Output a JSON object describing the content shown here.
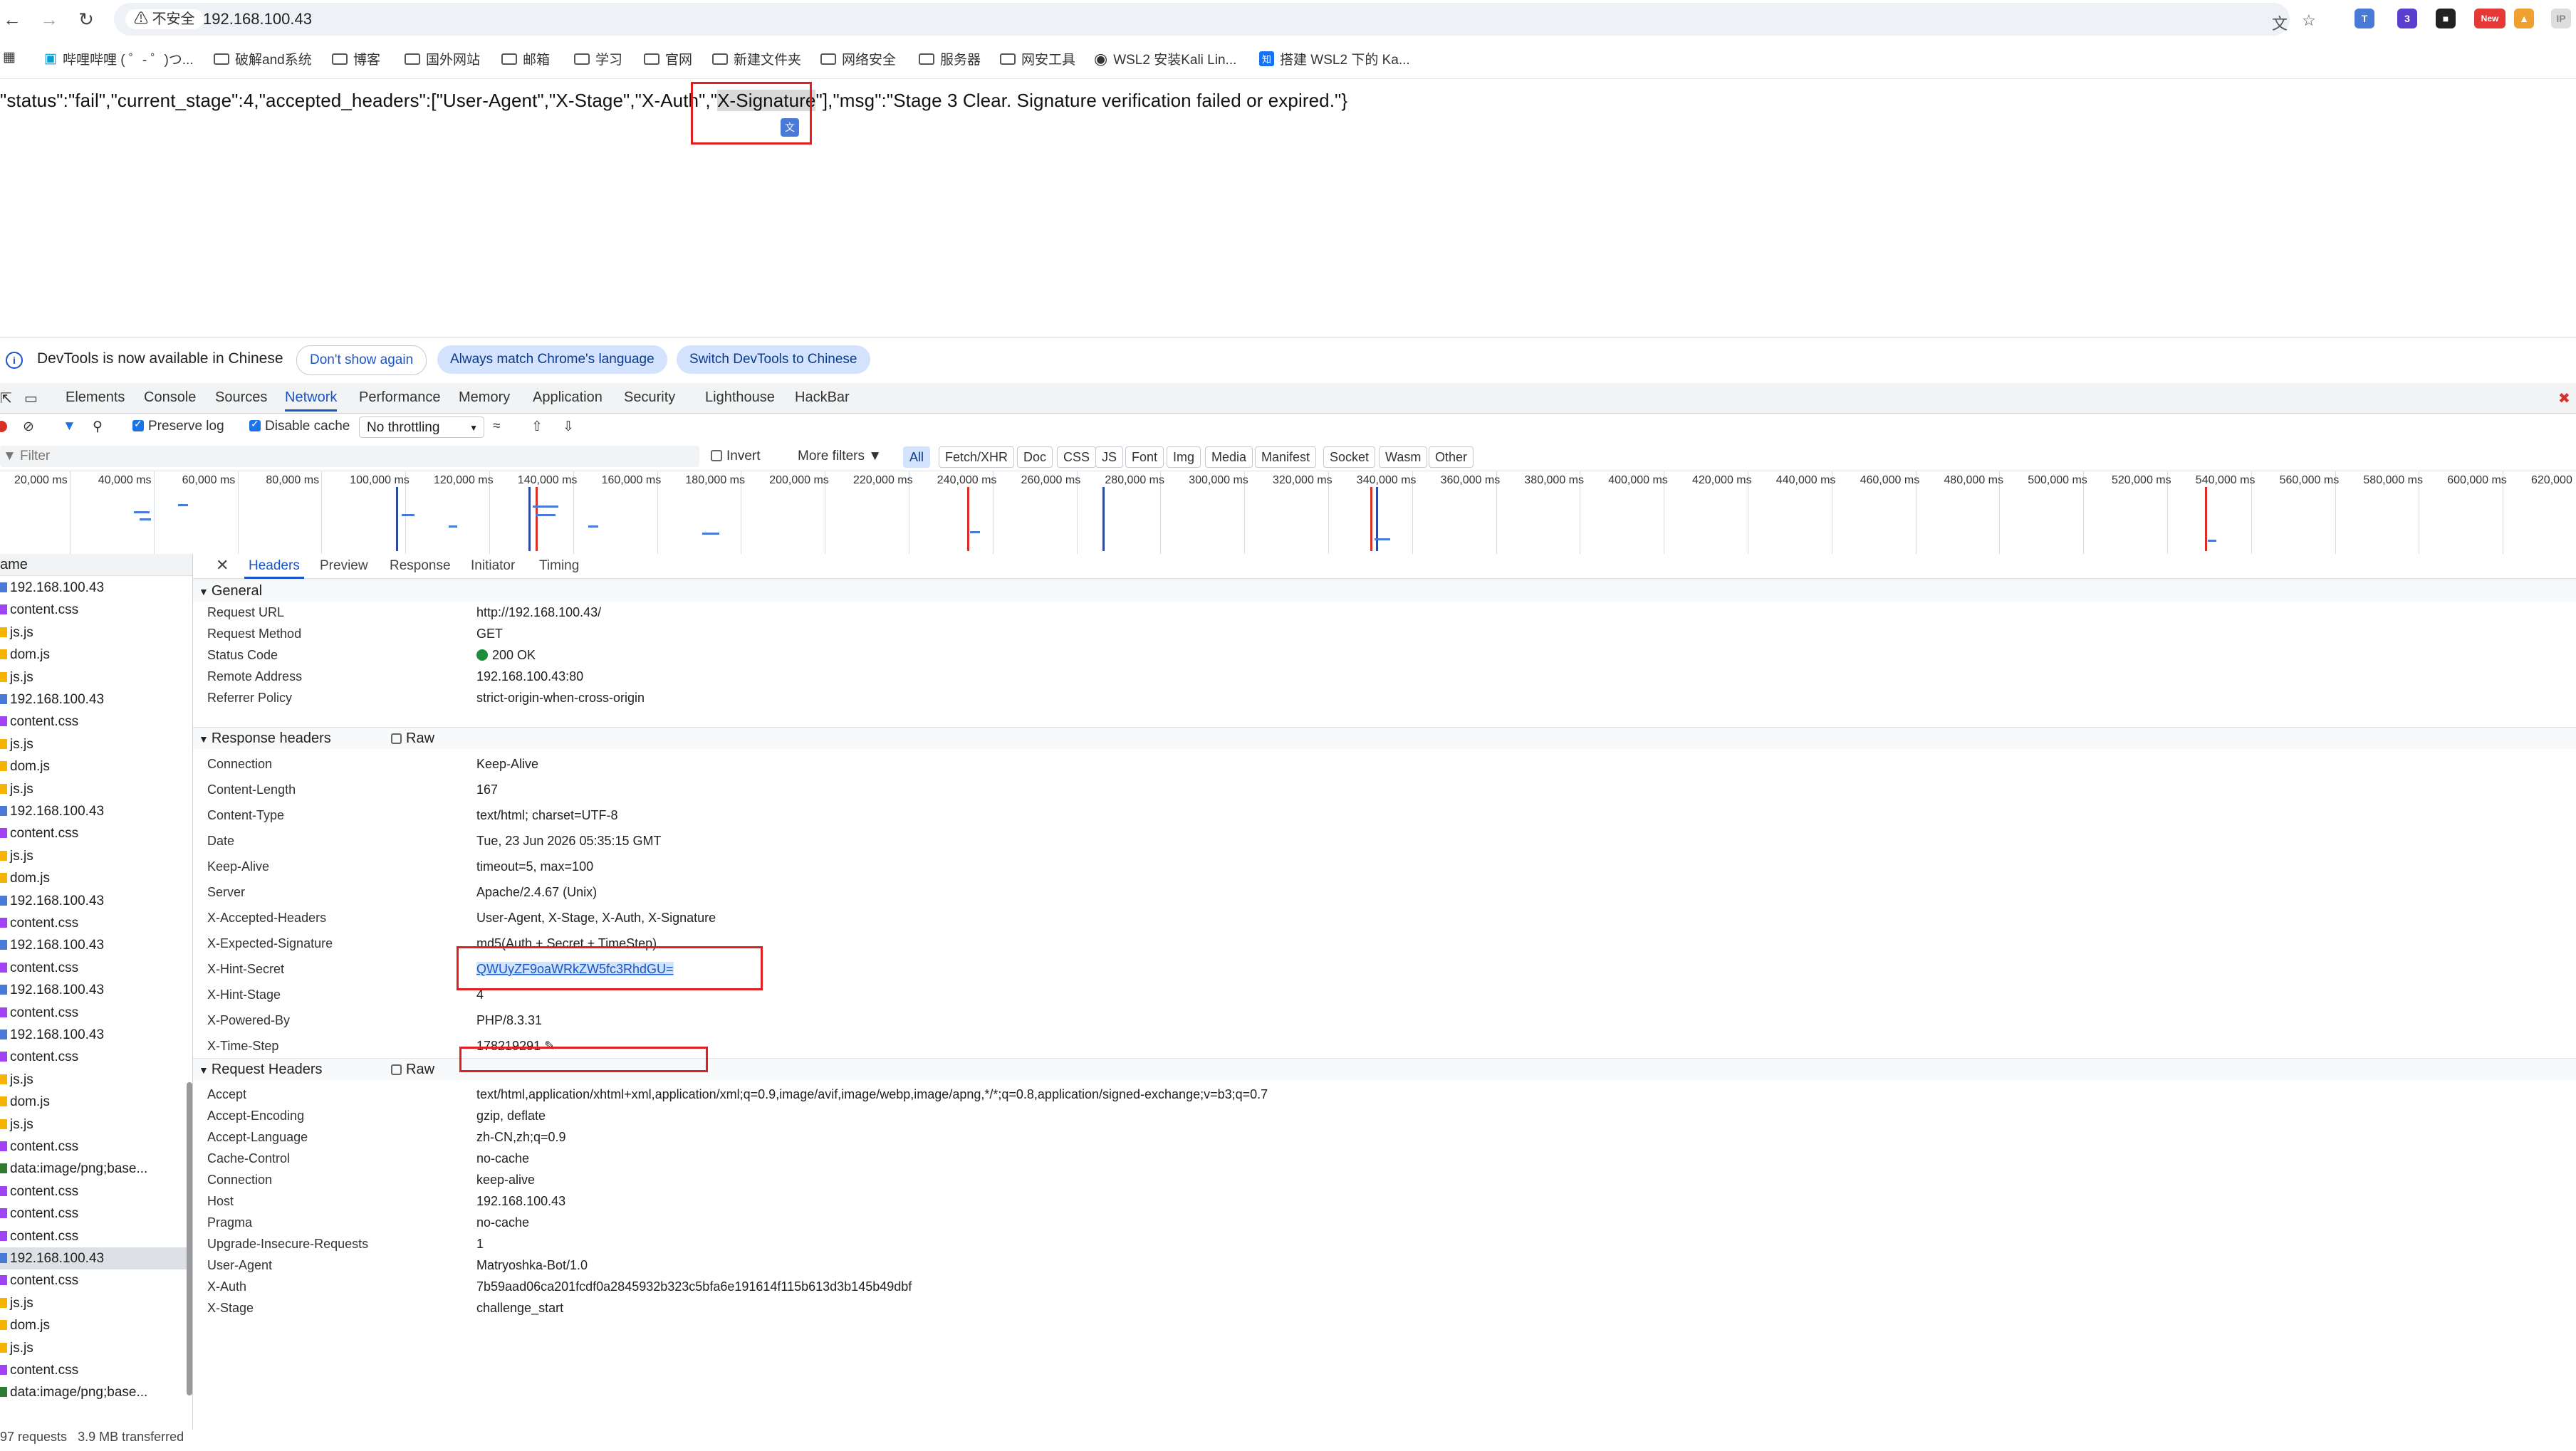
{
  "browser": {
    "security_label": "不安全",
    "url": "192.168.100.43",
    "bookmarks": [
      "哔哩哔哩 ( ゜- ゜)つ...",
      "破解and系统",
      "博客",
      "国外网站",
      "邮箱",
      "学习",
      "官网",
      "新建文件夹",
      "网络安全",
      "服务器",
      "网安工具",
      "WSL2 安装Kali Lin...",
      "搭建 WSL2 下的 Ka..."
    ],
    "ext_badge_new": "New",
    "ext_count": "3"
  },
  "page": {
    "text_before": "\"status\":\"fail\",\"current_stage\":4,\"accepted_headers\":[\"User-Agent\",\"X-Stage\",\"X-Auth\",\"",
    "text_highlight": "X-Signature",
    "text_after": "\"],\"msg\":\"Stage 3 Clear. Signature verification failed or expired.\"}"
  },
  "devtools": {
    "infobar": {
      "message": "DevTools is now available in Chinese",
      "dont_show": "Don't show again",
      "match_language": "Always match Chrome's language",
      "switch_chinese": "Switch DevTools to Chinese"
    },
    "tabs": [
      "Elements",
      "Console",
      "Sources",
      "Network",
      "Performance",
      "Memory",
      "Application",
      "Security",
      "Lighthouse",
      "HackBar"
    ],
    "active_tab": "Network",
    "toolbar": {
      "preserve_log": "Preserve log",
      "disable_cache": "Disable cache",
      "throttling": "No throttling"
    },
    "filter": {
      "placeholder": "Filter",
      "invert": "Invert",
      "more_filters": "More filters",
      "types": [
        "All",
        "Fetch/XHR",
        "Doc",
        "CSS",
        "JS",
        "Font",
        "Img",
        "Media",
        "Manifest",
        "Socket",
        "Wasm",
        "Other"
      ]
    },
    "timeline_ticks": [
      "20,000 ms",
      "40,000 ms",
      "60,000 ms",
      "80,000 ms",
      "100,000 ms",
      "120,000 ms",
      "140,000 ms",
      "160,000 ms",
      "180,000 ms",
      "200,000 ms",
      "220,000 ms",
      "240,000 ms",
      "260,000 ms",
      "280,000 ms",
      "300,000 ms",
      "320,000 ms",
      "340,000 ms",
      "360,000 ms",
      "380,000 ms",
      "400,000 ms",
      "420,000 ms",
      "440,000 ms",
      "460,000 ms",
      "480,000 ms",
      "500,000 ms",
      "520,000 ms",
      "540,000 ms",
      "560,000 ms",
      "580,000 ms",
      "600,000 ms",
      "620,000 ms"
    ],
    "request_list": {
      "header": "ame",
      "items": [
        "192.168.100.43",
        "content.css",
        "js.js",
        "dom.js",
        "js.js",
        "192.168.100.43",
        "content.css",
        "js.js",
        "dom.js",
        "js.js",
        "192.168.100.43",
        "content.css",
        "js.js",
        "dom.js",
        "192.168.100.43",
        "content.css",
        "192.168.100.43",
        "content.css",
        "192.168.100.43",
        "content.css",
        "192.168.100.43",
        "content.css",
        "js.js",
        "dom.js",
        "js.js",
        "content.css",
        "data:image/png;base...",
        "content.css",
        "content.css",
        "content.css",
        "192.168.100.43",
        "content.css",
        "js.js",
        "dom.js",
        "js.js",
        "content.css",
        "data:image/png;base..."
      ],
      "selected_index": 30,
      "footer_requests": "97 requests",
      "footer_transferred": "3.9 MB transferred"
    },
    "detail_tabs": [
      "Headers",
      "Preview",
      "Response",
      "Initiator",
      "Timing"
    ],
    "general": {
      "title": "General",
      "rows": [
        {
          "k": "Request URL",
          "v": "http://192.168.100.43/"
        },
        {
          "k": "Request Method",
          "v": "GET"
        },
        {
          "k": "Status Code",
          "v": "200 OK"
        },
        {
          "k": "Remote Address",
          "v": "192.168.100.43:80"
        },
        {
          "k": "Referrer Policy",
          "v": "strict-origin-when-cross-origin"
        }
      ]
    },
    "response_headers": {
      "title": "Response headers",
      "raw": "Raw",
      "rows": [
        {
          "k": "Connection",
          "v": "Keep-Alive"
        },
        {
          "k": "Content-Length",
          "v": "167"
        },
        {
          "k": "Content-Type",
          "v": "text/html; charset=UTF-8"
        },
        {
          "k": "Date",
          "v": "Tue, 23 Jun 2026 05:35:15 GMT"
        },
        {
          "k": "Keep-Alive",
          "v": "timeout=5, max=100"
        },
        {
          "k": "Server",
          "v": "Apache/2.4.67 (Unix)"
        },
        {
          "k": "X-Accepted-Headers",
          "v": "User-Agent, X-Stage, X-Auth, X-Signature"
        },
        {
          "k": "X-Expected-Signature",
          "v": "md5(Auth + Secret + TimeStep)"
        },
        {
          "k": "X-Hint-Secret",
          "v": "QWUyZF9oaWRkZW5fc3RhdGU="
        },
        {
          "k": "X-Hint-Stage",
          "v": "4"
        },
        {
          "k": "X-Powered-By",
          "v": "PHP/8.3.31"
        },
        {
          "k": "X-Time-Step",
          "v": "178219291"
        }
      ]
    },
    "request_headers": {
      "title": "Request Headers",
      "raw": "Raw",
      "rows": [
        {
          "k": "Accept",
          "v": "text/html,application/xhtml+xml,application/xml;q=0.9,image/avif,image/webp,image/apng,*/*;q=0.8,application/signed-exchange;v=b3;q=0.7"
        },
        {
          "k": "Accept-Encoding",
          "v": "gzip, deflate"
        },
        {
          "k": "Accept-Language",
          "v": "zh-CN,zh;q=0.9"
        },
        {
          "k": "Cache-Control",
          "v": "no-cache"
        },
        {
          "k": "Connection",
          "v": "keep-alive"
        },
        {
          "k": "Host",
          "v": "192.168.100.43"
        },
        {
          "k": "Pragma",
          "v": "no-cache"
        },
        {
          "k": "Upgrade-Insecure-Requests",
          "v": "1"
        },
        {
          "k": "User-Agent",
          "v": "Matryoshka-Bot/1.0"
        },
        {
          "k": "X-Auth",
          "v": "7b59aad06ca201fcdf0a2845932b323c5bfa6e191614f115b613d3b145b49dbf"
        },
        {
          "k": "X-Stage",
          "v": "challenge_start"
        }
      ]
    }
  },
  "colors": {
    "accent": "#1a55c7",
    "annotation": "#e02020",
    "status_ok": "#1e8e3e"
  }
}
